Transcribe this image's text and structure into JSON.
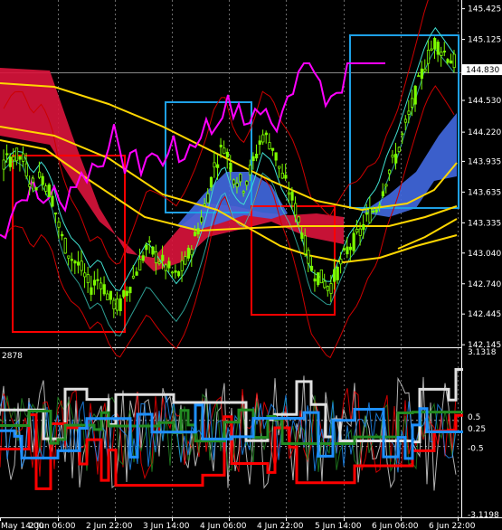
{
  "chart_data": {
    "type": "line",
    "price_axis": {
      "ticks": [
        "145.425",
        "145.125",
        "144.830",
        "144.530",
        "144.220",
        "143.935",
        "143.635",
        "143.335",
        "143.040",
        "142.740",
        "142.445",
        "142.145"
      ],
      "current_price": "144.830",
      "range": [
        142.12,
        145.51
      ]
    },
    "time_axis": {
      "ticks": [
        "May 14:00",
        "2 Jun 06:00",
        "2 Jun 22:00",
        "3 Jun 14:00",
        "4 Jun 06:00",
        "4 Jun 22:00",
        "5 Jun 14:00",
        "6 Jun 06:00",
        "6 Jun 22:00"
      ]
    },
    "oscillator": {
      "ticks": [
        "3.1318",
        "0.5",
        "0.25",
        "-0.5",
        "-3.1198"
      ],
      "range": [
        -3.1198,
        3.1318
      ],
      "levels": [
        0.5,
        -0.5
      ]
    },
    "colors": {
      "background": "#000000",
      "candle_up": "#7CFC00",
      "candle_down": "#7CFC00",
      "cloud_bear": "#DC143C",
      "cloud_bull": "#4169E1",
      "box_red": "#FF0000",
      "box_blue": "#1EA0E6",
      "ma_gold": "#FFD700",
      "bands": "#CC0000",
      "magenta": "#FF00FF",
      "cyan": "#40E0D0",
      "osc_white": "#E0E0E0",
      "osc_red": "#FF0000",
      "osc_green": "#228B22",
      "osc_blue": "#1E90FF"
    },
    "series": [
      {
        "values": [
          143.9,
          144.0,
          143.95,
          143.7,
          143.8,
          143.6,
          143.2,
          143.0,
          142.9,
          142.7,
          142.8,
          142.6,
          142.5,
          142.7,
          142.9,
          143.1,
          143.0,
          142.9,
          142.8,
          142.95,
          143.2,
          143.5,
          143.9,
          144.1,
          143.8,
          143.7,
          143.9,
          144.2,
          144.1,
          143.8,
          143.6,
          143.3,
          142.9,
          142.8,
          142.7,
          142.9,
          143.1,
          143.2,
          143.4,
          143.5,
          143.8,
          144.0,
          144.3,
          144.6,
          144.9,
          145.1,
          145.0,
          144.9
        ]
      }
    ]
  },
  "subpane": {
    "left_value": "2878"
  }
}
